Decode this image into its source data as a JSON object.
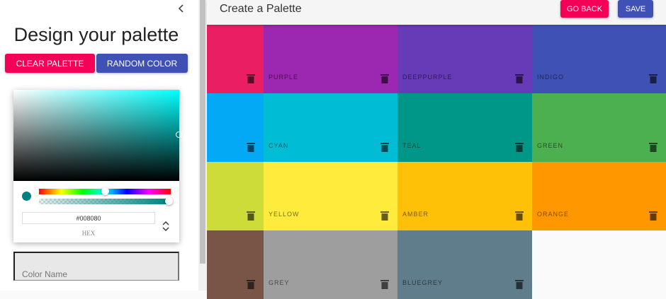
{
  "sidebar": {
    "title": "Design your palette",
    "clear_label": "CLEAR PALETTE",
    "random_label": "RANDOM COLOR",
    "color_name_placeholder": "Color Name"
  },
  "picker": {
    "hex_value": "#008080",
    "hex_label": "HEX",
    "current_color": "#008080"
  },
  "header": {
    "title": "Create a Palette",
    "back_label": "GO BACK",
    "save_label": "SAVE"
  },
  "colors": {
    "accent_pink": "#f50057",
    "accent_indigo": "#3f51b5"
  },
  "palette": [
    {
      "name": "",
      "color": "#e91e63"
    },
    {
      "name": "PURPLE",
      "color": "#9c27b0"
    },
    {
      "name": "DEEPPURPLE",
      "color": "#673ab7"
    },
    {
      "name": "INDIGO",
      "color": "#3f51b5"
    },
    {
      "name": "",
      "color": "#03a9f4"
    },
    {
      "name": "CYAN",
      "color": "#00bcd4"
    },
    {
      "name": "TEAL",
      "color": "#009688"
    },
    {
      "name": "GREEN",
      "color": "#4caf50"
    },
    {
      "name": "",
      "color": "#cddc39"
    },
    {
      "name": "YELLOW",
      "color": "#ffeb3b"
    },
    {
      "name": "AMBER",
      "color": "#ffc107"
    },
    {
      "name": "ORANGE",
      "color": "#ff9800"
    },
    {
      "name": "",
      "color": "#795548"
    },
    {
      "name": "GREY",
      "color": "#9e9e9e"
    },
    {
      "name": "BLUEGREY",
      "color": "#607d8b"
    }
  ]
}
